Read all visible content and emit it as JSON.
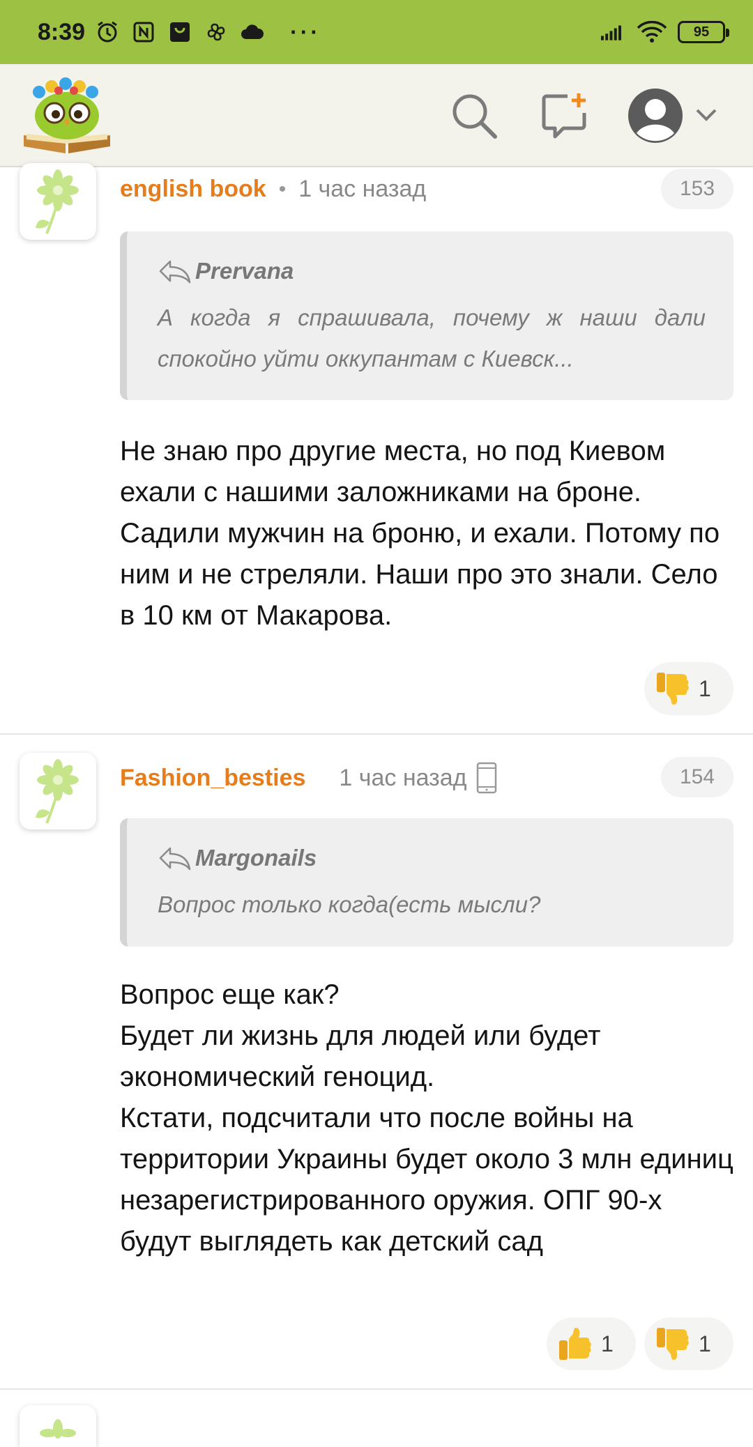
{
  "status_bar": {
    "time": "8:39",
    "battery": "95"
  },
  "app": {
    "logo": "owl-reading-book-logo"
  },
  "header_icons": {
    "search": "search-icon",
    "new_post": "new-message-icon",
    "profile": "user-avatar-icon",
    "menu": "chevron-down-icon"
  },
  "comments": [
    {
      "author": "english book",
      "separator": "•",
      "time": "1 час назад",
      "number": "153",
      "quote": {
        "author": "Prervana",
        "text": "А когда я спрашивала, почему ж наши дали спокойно уйти оккупантам с Киевск..."
      },
      "body": "Не знаю про другие места, но под Киевом ехали с нашими заложниками на броне. Садили мужчин на броню, и ехали. Потому по ним и не стреляли. Наши про это знали. Село в 10 км от Макарова.",
      "reactions": {
        "dislike": "1"
      }
    },
    {
      "author": "Fashion_besties",
      "time": "1 час назад",
      "number": "154",
      "quote": {
        "author": "Margonails",
        "text": "Вопрос только когда(есть мысли?"
      },
      "body": "Вопрос еще как?\nБудет ли жизнь для людей или будет экономический геноцид.\nКстати, подсчитали что после войны на территории Украины будет около 3 млн единиц незарегистрированного оружия. ОПГ 90-х будут выглядеть как детский сад",
      "reactions": {
        "like": "1",
        "dislike": "1"
      }
    }
  ],
  "colors": {
    "status_bar": "#9dc243",
    "author": "#e57d1c",
    "app_bar": "#f3f3ec"
  }
}
